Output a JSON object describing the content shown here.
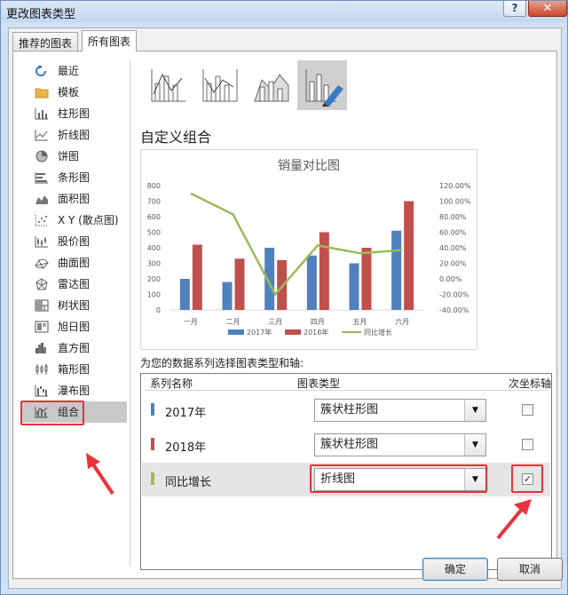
{
  "window": {
    "title": "更改图表类型",
    "help_label": "?",
    "close_label": "✕"
  },
  "tabs": [
    {
      "label": "推荐的图表"
    },
    {
      "label": "所有图表"
    }
  ],
  "sidebar": {
    "items": [
      {
        "label": "最近",
        "icon": "recent-icon"
      },
      {
        "label": "模板",
        "icon": "folder-icon"
      },
      {
        "label": "柱形图",
        "icon": "column-chart-icon"
      },
      {
        "label": "折线图",
        "icon": "line-chart-icon"
      },
      {
        "label": "饼图",
        "icon": "pie-chart-icon"
      },
      {
        "label": "条形图",
        "icon": "bar-chart-icon"
      },
      {
        "label": "面积图",
        "icon": "area-chart-icon"
      },
      {
        "label": "X Y (散点图)",
        "icon": "scatter-chart-icon"
      },
      {
        "label": "股价图",
        "icon": "stock-chart-icon"
      },
      {
        "label": "曲面图",
        "icon": "surface-chart-icon"
      },
      {
        "label": "雷达图",
        "icon": "radar-chart-icon"
      },
      {
        "label": "树状图",
        "icon": "treemap-chart-icon"
      },
      {
        "label": "旭日图",
        "icon": "sunburst-chart-icon"
      },
      {
        "label": "直方图",
        "icon": "histogram-chart-icon"
      },
      {
        "label": "箱形图",
        "icon": "box-whisker-chart-icon"
      },
      {
        "label": "瀑布图",
        "icon": "waterfall-chart-icon"
      },
      {
        "label": "组合",
        "icon": "combo-chart-icon",
        "selected": true
      }
    ]
  },
  "combo_subtypes": [
    {
      "icon": "clustered-column-line-icon"
    },
    {
      "icon": "clustered-column-line-secondary-axis-icon"
    },
    {
      "icon": "stacked-area-clustered-column-icon"
    },
    {
      "icon": "custom-combination-icon",
      "selected": true
    }
  ],
  "section_title": "自定义组合",
  "chart_data": {
    "type": "bar",
    "title": "销量对比图",
    "categories": [
      "一月",
      "二月",
      "三月",
      "四月",
      "五月",
      "六月"
    ],
    "series": [
      {
        "name": "2017年",
        "type": "bar",
        "axis": "primary",
        "values": [
          200,
          180,
          400,
          350,
          300,
          510
        ],
        "color": "#4f81bd"
      },
      {
        "name": "2018年",
        "type": "bar",
        "axis": "primary",
        "values": [
          420,
          330,
          320,
          500,
          400,
          700
        ],
        "color": "#c0504d"
      },
      {
        "name": "同比增长",
        "type": "line",
        "axis": "secondary",
        "values": [
          1.1,
          0.83,
          -0.2,
          0.43,
          0.33,
          0.37
        ],
        "color": "#9bbb59"
      }
    ],
    "ylim": [
      0,
      800
    ],
    "y_ticks": [
      "0",
      "100",
      "200",
      "300",
      "400",
      "500",
      "600",
      "700",
      "800"
    ],
    "y2lim": [
      -0.4,
      1.2
    ],
    "y2_ticks": [
      "-40.00%",
      "-20.00%",
      "0.00%",
      "20.00%",
      "40.00%",
      "60.00%",
      "80.00%",
      "100.00%",
      "120.00%"
    ],
    "grid": false,
    "legend": "bottom"
  },
  "series_config": {
    "instruction": "为您的数据系列选择图表类型和轴:",
    "col_name": "系列名称",
    "col_type": "图表类型",
    "col_secondary": "次坐标轴",
    "rows": [
      {
        "name": "2017年",
        "chart_type": "簇状柱形图",
        "secondary_axis": false,
        "color": "#4f81bd"
      },
      {
        "name": "2018年",
        "chart_type": "簇状柱形图",
        "secondary_axis": false,
        "color": "#c0504d"
      },
      {
        "name": "同比增长",
        "chart_type": "折线图",
        "secondary_axis": true,
        "color": "#9bbb59"
      }
    ]
  },
  "buttons": {
    "ok": "确定",
    "cancel": "取消"
  }
}
